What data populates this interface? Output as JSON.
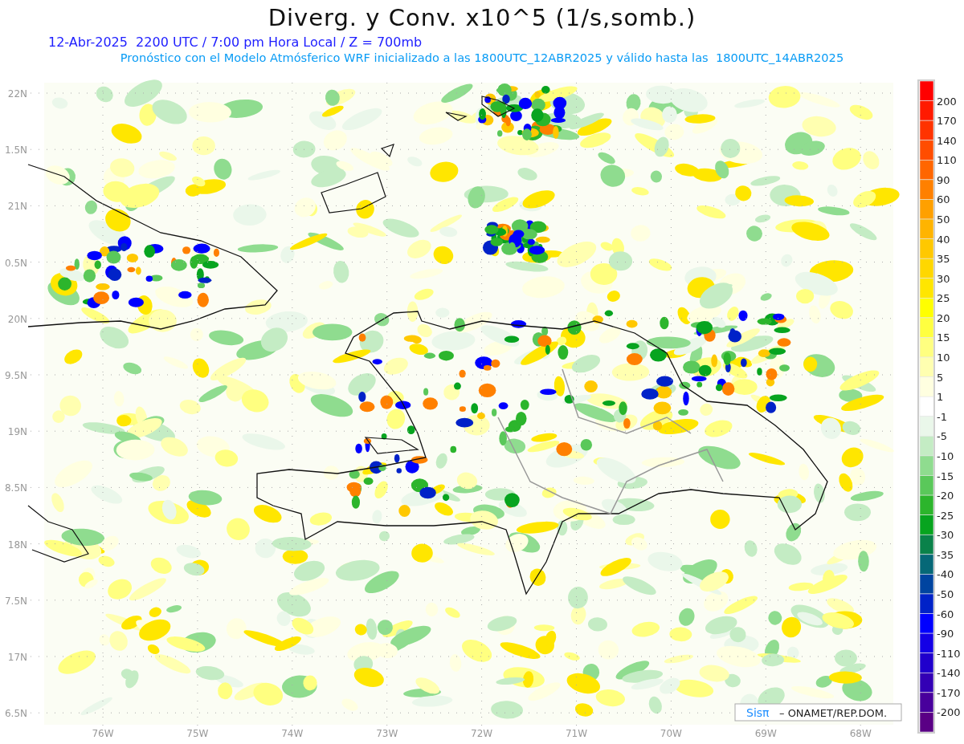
{
  "title": "Diverg. y Conv. x10^5 (1/s,somb.)",
  "subtitle": "12-Abr-2025  2200 UTC / 7:00 pm Hora Local / Z = 700mb",
  "forecast_note": "Pronóstico con el Modelo Atmósferico WRF inicializado a las 1800UTC_12ABR2025 y válido hasta las  1800UTC_14ABR2025",
  "y_axis": {
    "labels": [
      "22N",
      "1.5N",
      "21N",
      "0.5N",
      "20N",
      "9.5N",
      "19N",
      "8.5N",
      "18N",
      "7.5N",
      "17N",
      "6.5N"
    ]
  },
  "x_axis": {
    "labels": [
      "76W",
      "75W",
      "74W",
      "73W",
      "72W",
      "71W",
      "70W",
      "69W",
      "68W"
    ]
  },
  "colorbar": {
    "bins": [
      {
        "color": "#ff0000"
      },
      {
        "color": "#ff1a00"
      },
      {
        "color": "#ff3300"
      },
      {
        "color": "#ff4d00"
      },
      {
        "color": "#ff6600"
      },
      {
        "color": "#ff8000"
      },
      {
        "color": "#ffa000"
      },
      {
        "color": "#ffb400"
      },
      {
        "color": "#ffc800"
      },
      {
        "color": "#ffd700"
      },
      {
        "color": "#ffe600"
      },
      {
        "color": "#ffff00"
      },
      {
        "color": "#ffff40"
      },
      {
        "color": "#ffff80"
      },
      {
        "color": "#ffffb0"
      },
      {
        "color": "#ffffe0"
      },
      {
        "color": "#ffffff"
      },
      {
        "color": "#eaf7ea"
      },
      {
        "color": "#c4ecc4"
      },
      {
        "color": "#8fdc8f"
      },
      {
        "color": "#5ac85a"
      },
      {
        "color": "#2cb52c"
      },
      {
        "color": "#07a41f"
      },
      {
        "color": "#0a824a"
      },
      {
        "color": "#066877"
      },
      {
        "color": "#0044a0"
      },
      {
        "color": "#0022c8"
      },
      {
        "color": "#0000ff"
      },
      {
        "color": "#1400e6"
      },
      {
        "color": "#2000cc"
      },
      {
        "color": "#3300b5"
      },
      {
        "color": "#48009c"
      },
      {
        "color": "#5a0085"
      }
    ],
    "labels": [
      "200",
      "170",
      "140",
      "110",
      "90",
      "60",
      "50",
      "40",
      "35",
      "30",
      "25",
      "20",
      "15",
      "10",
      "5",
      "1",
      "-1",
      "-5",
      "-10",
      "-15",
      "-20",
      "-25",
      "-30",
      "-35",
      "-40",
      "-50",
      "-60",
      "-90",
      "-110",
      "-140",
      "-170",
      "-200"
    ]
  },
  "credit": {
    "logo": "Sisπ",
    "text": "– ONAMET/REP.DOM."
  }
}
